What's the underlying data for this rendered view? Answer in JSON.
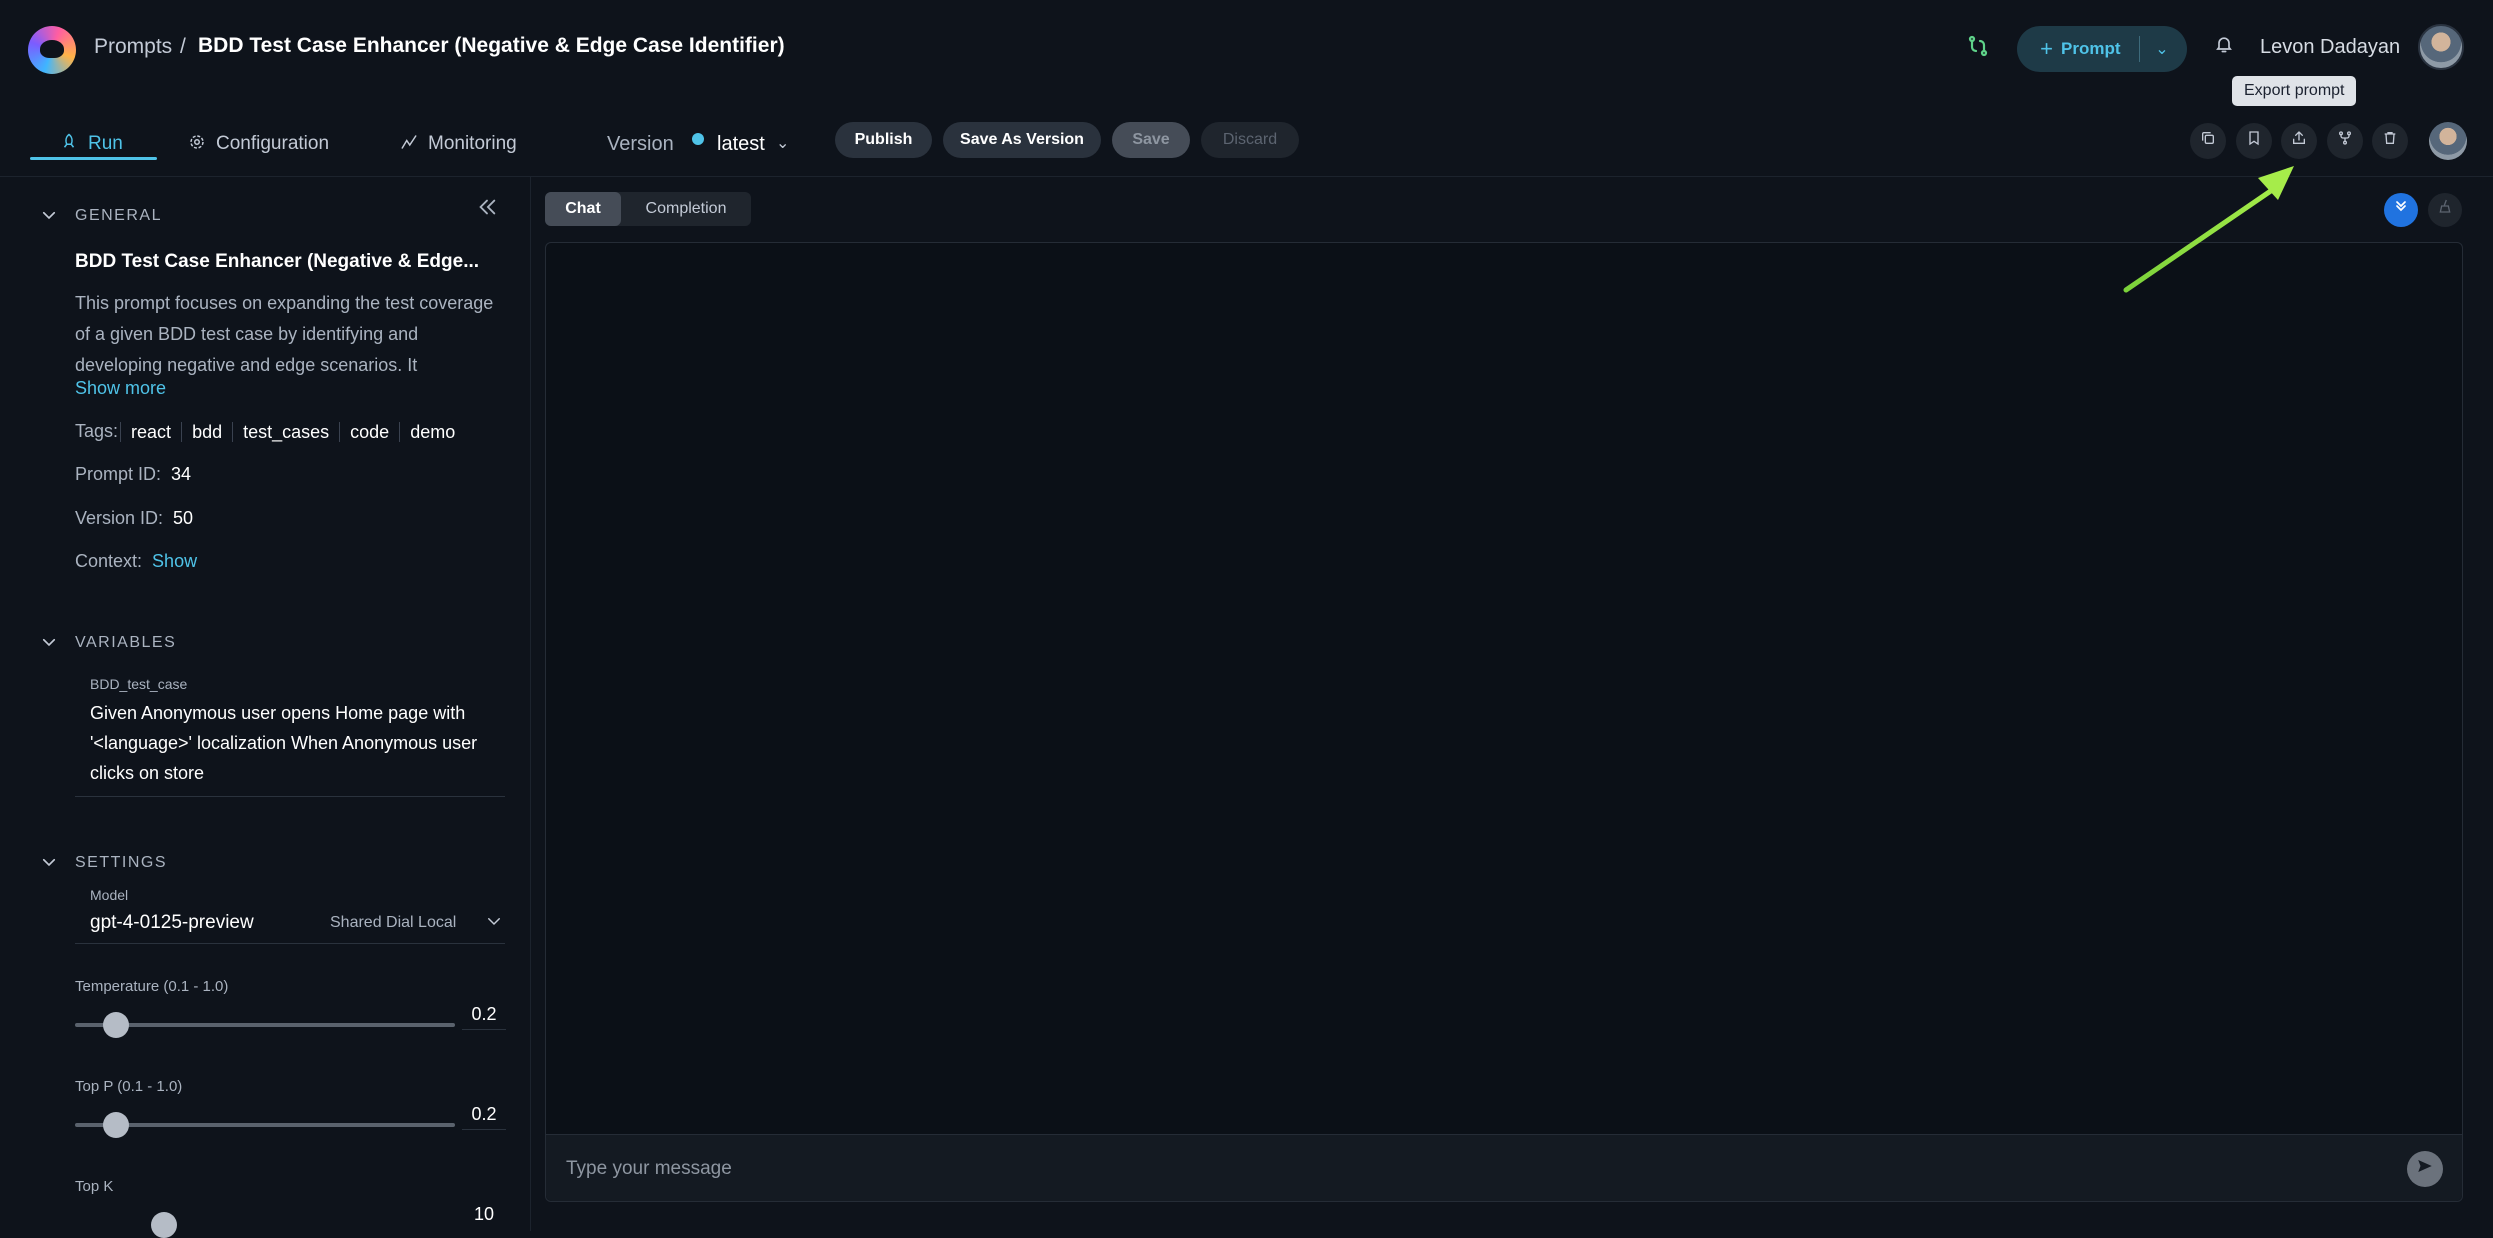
{
  "header": {
    "breadcrumb_root": "Prompts",
    "breadcrumb_sep": "/",
    "title": "BDD Test Case Enhancer (Negative & Edge Case Identifier)",
    "prompt_button": "Prompt",
    "user_name": "Levon Dadayan",
    "tooltip": "Export prompt"
  },
  "tabs": [
    {
      "label": "Run"
    },
    {
      "label": "Configuration"
    },
    {
      "label": "Monitoring"
    }
  ],
  "version": {
    "label": "Version",
    "value": "latest"
  },
  "actions": {
    "publish": "Publish",
    "save_as_version": "Save As Version",
    "save": "Save",
    "discard": "Discard"
  },
  "sidebar": {
    "general": {
      "title": "GENERAL",
      "prompt_name": "BDD Test Case Enhancer (Negative & Edge...",
      "description": "This prompt focuses on expanding the test coverage of a given BDD test case by identifying and developing negative and edge scenarios. It",
      "show_more": "Show more",
      "tags_label": "Tags:",
      "tags": [
        "react",
        "bdd",
        "test_cases",
        "code",
        "demo"
      ],
      "prompt_id_label": "Prompt ID:",
      "prompt_id": "34",
      "version_id_label": "Version ID:",
      "version_id": "50",
      "context_label": "Context:",
      "context_link": "Show"
    },
    "variables": {
      "title": "VARIABLES",
      "var_name": "BDD_test_case",
      "var_value": "Given Anonymous user opens Home page with '<language>' localization When Anonymous user clicks on store"
    },
    "settings": {
      "title": "SETTINGS",
      "model_label": "Model",
      "model_value": "gpt-4-0125-preview",
      "model_provider": "Shared Dial Local",
      "temperature_label": "Temperature (0.1 - 1.0)",
      "temperature_value": "0.2",
      "top_p_label": "Top P (0.1 - 1.0)",
      "top_p_value": "0.2",
      "top_k_label": "Top K",
      "top_k_value": "10"
    }
  },
  "main": {
    "mode_chat": "Chat",
    "mode_completion": "Completion",
    "input_placeholder": "Type your message"
  }
}
